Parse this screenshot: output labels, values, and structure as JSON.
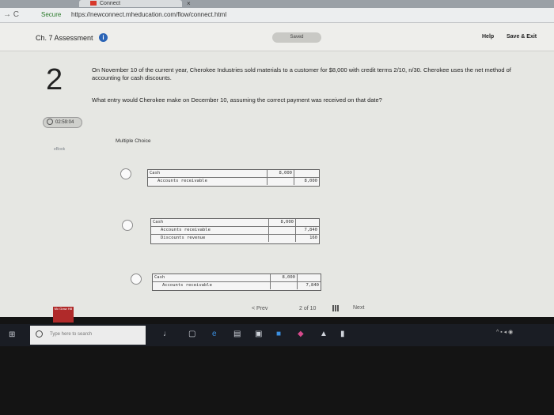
{
  "browser": {
    "tab_title": "Connect",
    "tab_close": "×",
    "nav": "→ C",
    "secure_label": "Secure",
    "url": "https://newconnect.mheducation.com/flow/connect.html"
  },
  "header": {
    "assessment_title": "Ch. 7 Assessment",
    "info_icon": "i",
    "saved_label": "Saved",
    "help_label": "Help",
    "save_exit_label": "Save & Exit"
  },
  "question": {
    "number": "2",
    "text": "On November 10 of the current year, Cherokee Industries sold materials to a customer for $8,000 with credit terms 2/10, n/30. Cherokee uses the net method of accounting for cash discounts.",
    "prompt": "What entry would Cherokee make on December 10, assuming the correct payment was received on that date?",
    "timer": "02:59:04",
    "ebook_label": "eBook",
    "type_label": "Multiple Choice"
  },
  "options": [
    {
      "rows": [
        {
          "account": "Cash",
          "debit": "8,000",
          "credit": ""
        },
        {
          "account": "Accounts receivable",
          "debit": "",
          "credit": "8,000"
        }
      ]
    },
    {
      "rows": [
        {
          "account": "Cash",
          "debit": "8,000",
          "credit": ""
        },
        {
          "account": "Accounts receivable",
          "debit": "",
          "credit": "7,840"
        },
        {
          "account": "Discounts revenue",
          "debit": "",
          "credit": "160"
        }
      ]
    },
    {
      "rows": [
        {
          "account": "Cash",
          "debit": "8,000",
          "credit": ""
        },
        {
          "account": "Accounts receivable",
          "debit": "",
          "credit": "7,840"
        }
      ]
    }
  ],
  "footer": {
    "prev_label": "< Prev",
    "page_current": "2",
    "page_of": "of",
    "page_total": "10",
    "next_label": "Next",
    "logo_text": "Mc Graw Hill"
  },
  "taskbar": {
    "search_placeholder": "Type here to search"
  }
}
